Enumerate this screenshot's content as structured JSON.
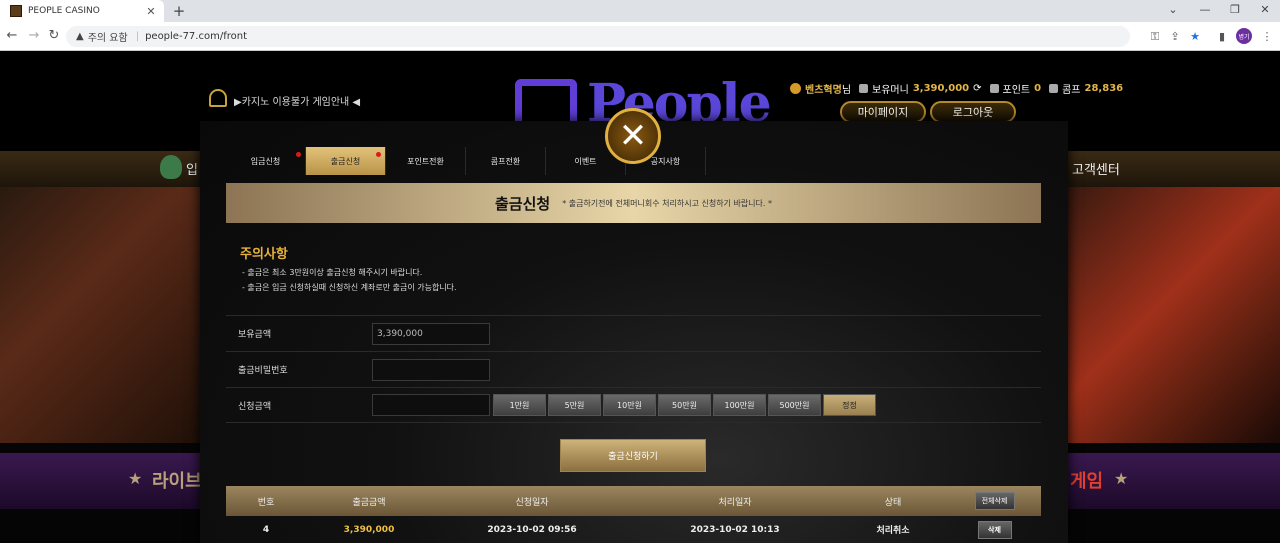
{
  "browser": {
    "tab_title": "PEOPLE CASINO",
    "security_label": "주의 요함",
    "url": "people-77.com/front",
    "profile_initials": "병기"
  },
  "site": {
    "notice_ticker": "▶카지노 이용불가 게임안내 ◀",
    "logo_text": "People",
    "user": {
      "name": "벤츠혁명",
      "name_suffix": "님",
      "balance_label": "보유머니",
      "balance": "3,390,000",
      "point_label": "포인트",
      "point": "0",
      "comp_label": "콤프",
      "comp": "28,836"
    },
    "mypage_label": "마이페이지",
    "logout_label": "로그아웃",
    "menu_left_fragment": "입",
    "menu_right_fragment": "고객센터",
    "strip_left_text": "라이브",
    "strip_right_text": "게임"
  },
  "modal": {
    "tabs": [
      {
        "label": "입금신청",
        "active": false,
        "dot": true
      },
      {
        "label": "출금신청",
        "active": true,
        "dot": true
      },
      {
        "label": "포인트전환",
        "active": false,
        "dot": false
      },
      {
        "label": "콤프전환",
        "active": false,
        "dot": false
      },
      {
        "label": "이벤트",
        "active": false,
        "dot": false
      },
      {
        "label": "공지사항",
        "active": false,
        "dot": false
      }
    ],
    "title": "출금신청",
    "subtitle": "* 출금하기전에 전체머니회수 처리하시고 신청하기 바랍니다. *",
    "notice_title": "주의사항",
    "notice_lines": [
      "- 출금은 최소 3만원이상 출금신청 해주시기 바랍니다.",
      "- 출금은 입금 신청하실때 신청하신 계좌로만 출금이 가능합니다."
    ],
    "form": {
      "balance_label": "보유금액",
      "balance_value": "3,390,000",
      "password_label": "출금비밀번호",
      "password_value": "",
      "amount_label": "신청금액",
      "amount_value": "",
      "amount_buttons": [
        "1만원",
        "5만원",
        "10만원",
        "50만원",
        "100만원",
        "500만원"
      ],
      "reset_label": "정정"
    },
    "submit_label": "출금신청하기",
    "history": {
      "headers": [
        "번호",
        "출금금액",
        "신청일자",
        "처리일자",
        "상태"
      ],
      "delete_all_label": "전체삭제",
      "rows": [
        {
          "no": "4",
          "amount": "3,390,000",
          "requested": "2023-10-02 09:56",
          "processed": "2023-10-02 10:13",
          "status": "처리취소",
          "delete_label": "삭제"
        }
      ]
    }
  },
  "colors": {
    "gold": "#e2b64a",
    "amount_gold": "#f0c040",
    "status_cancel": "#e9e9e9"
  }
}
